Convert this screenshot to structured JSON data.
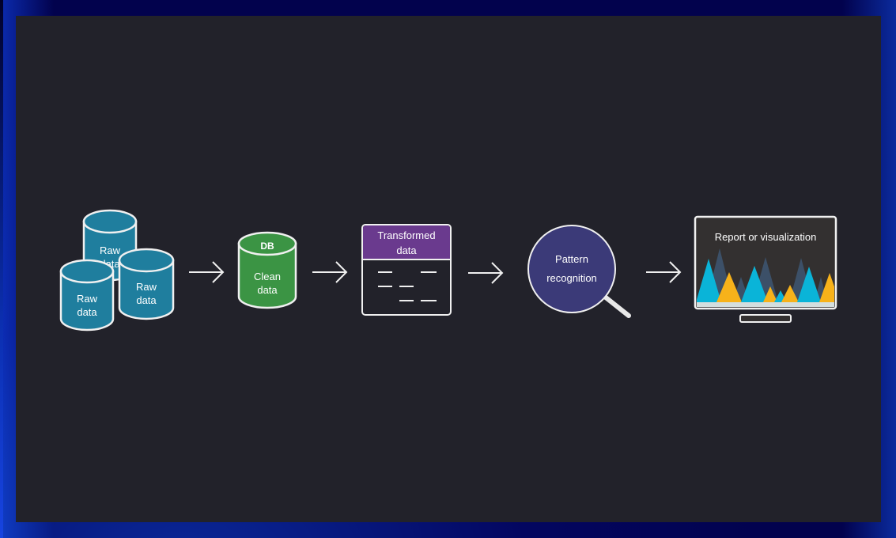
{
  "colors": {
    "panel_bg": "#22222a",
    "raw_data": "#1f7e9e",
    "clean_data": "#3b9444",
    "transformed_header": "#6a3a8e",
    "pattern": "#3b3a78",
    "stroke": "#f0f0f0",
    "viz_bg": "#333030",
    "viz_cyan": "#0ab4d8",
    "viz_amber": "#f7b21a",
    "viz_slate": "#3c5068",
    "viz_base": "#d4dede"
  },
  "pipeline": {
    "raw_data": {
      "labels": [
        {
          "line1": "Raw",
          "line2": "data"
        },
        {
          "line1": "Raw",
          "line2": "data"
        },
        {
          "line1": "Raw",
          "line2": "data"
        }
      ]
    },
    "clean_data": {
      "badge": "DB",
      "line1": "Clean",
      "line2": "data"
    },
    "transformed_data": {
      "line1": "Transformed",
      "line2": "data"
    },
    "pattern_recognition": {
      "line1": "Pattern",
      "line2": "recognition"
    },
    "report": {
      "title": "Report or visualization"
    }
  },
  "arrows": [
    "raw-to-clean",
    "clean-to-transformed",
    "transformed-to-pattern",
    "pattern-to-report"
  ]
}
